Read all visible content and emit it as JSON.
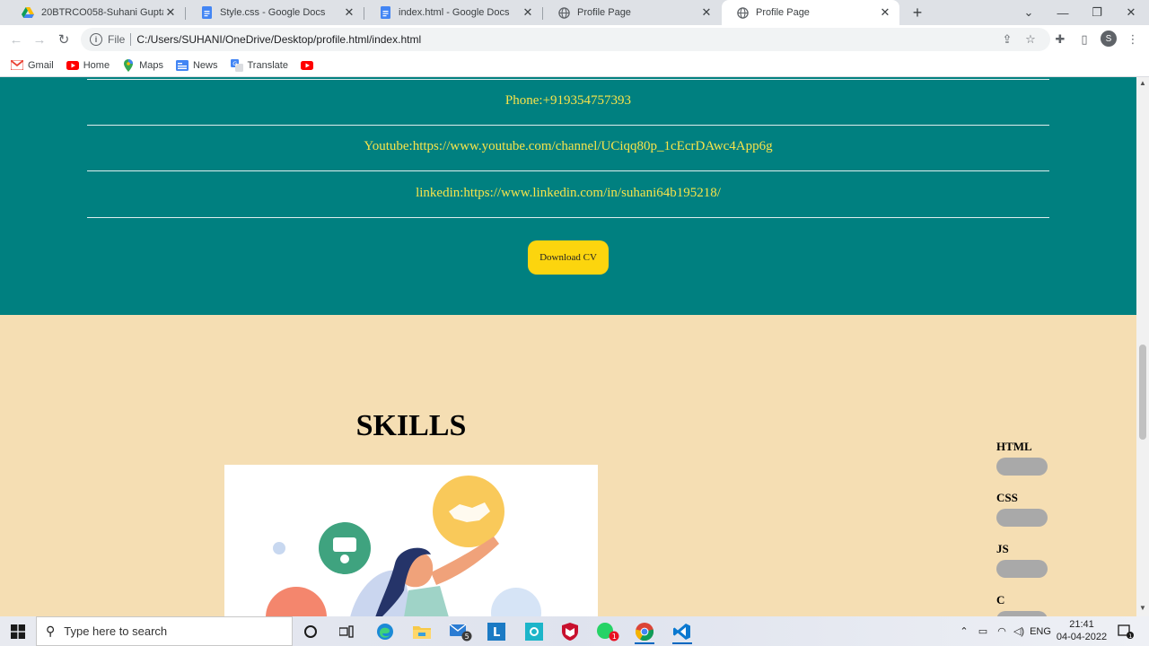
{
  "browser": {
    "tabs": [
      {
        "title": "20BTRCO058-Suhani Gupta - Goo",
        "icon": "google-drive-icon"
      },
      {
        "title": "Style.css - Google Docs",
        "icon": "google-docs-icon"
      },
      {
        "title": "index.html - Google Docs",
        "icon": "google-docs-icon"
      },
      {
        "title": "Profile Page",
        "icon": "globe-icon"
      },
      {
        "title": "Profile Page",
        "icon": "globe-icon",
        "active": true
      }
    ],
    "address": {
      "scheme": "File",
      "url": "C:/Users/SUHANI/OneDrive/Desktop/profile.html/index.html"
    },
    "profile_initial": "S",
    "bookmarks": [
      {
        "label": "Gmail",
        "icon": "gmail-icon"
      },
      {
        "label": "Home",
        "icon": "youtube-icon"
      },
      {
        "label": "Maps",
        "icon": "maps-icon"
      },
      {
        "label": "News",
        "icon": "news-icon"
      },
      {
        "label": "Translate",
        "icon": "translate-icon"
      },
      {
        "label": "",
        "icon": "youtube-icon"
      }
    ]
  },
  "page": {
    "contacts": {
      "phone": "Phone:+919354757393",
      "youtube": "Youtube:https://www.youtube.com/channel/UCiqq80p_1cEcrDAwc4App6g",
      "linkedin": "linkedin:https://www.linkedin.com/in/suhani64b195218/"
    },
    "download_label": "Download CV",
    "skills_title": "SKILLS",
    "skills": [
      "HTML",
      "CSS",
      "JS",
      "C"
    ],
    "colors": {
      "teal": "#008080",
      "wheat": "#f5deb3",
      "link_yellow": "#f7e34a",
      "button_yellow": "#fcd50e"
    }
  },
  "taskbar": {
    "search_placeholder": "Type here to search",
    "mail_badge": "5",
    "whatsapp_badge": "1",
    "language": "ENG",
    "time": "21:41",
    "date": "04-04-2022",
    "notification_count": "1"
  }
}
